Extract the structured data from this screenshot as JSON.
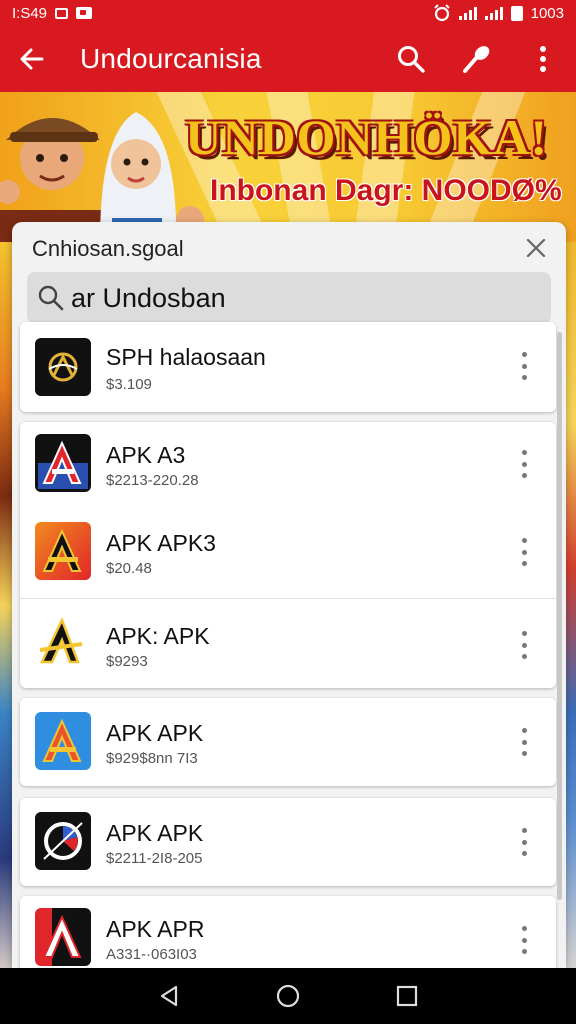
{
  "status_bar": {
    "time": "I:S49",
    "battery": "1003"
  },
  "app_bar": {
    "title": "Undourcanisia"
  },
  "banner": {
    "headline": "UNDONHÖKA!",
    "subline": "Inbonan Dagr: NOODØ%"
  },
  "dialog": {
    "title": "Cnhiosan.sgoal",
    "search_value": "ar Undosban"
  },
  "apps": [
    {
      "name": "SPH halaosaan",
      "sub": "$3.109"
    },
    {
      "name": "APK A3",
      "sub": "$2213-220.28"
    },
    {
      "name": "APK APK3",
      "sub": "$20.48"
    },
    {
      "name": "APK: APK",
      "sub": "$9293"
    },
    {
      "name": "APK APK",
      "sub": "$929$8nn 7I3"
    },
    {
      "name": "APK APK",
      "sub": "$2211-2I8-205"
    },
    {
      "name": "APK APR",
      "sub": "A331-·063I03"
    }
  ],
  "colors": {
    "brand_red": "#d8191f",
    "nav_black": "#000000"
  },
  "icons": [
    "arrow-back-icon",
    "search-icon",
    "brush-icon",
    "more-vert-icon",
    "close-icon",
    "nav-back-icon",
    "nav-home-icon",
    "nav-recents-icon"
  ]
}
